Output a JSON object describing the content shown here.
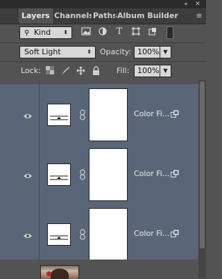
{
  "panel": {
    "tabs": [
      {
        "label": "Layers",
        "active": true
      },
      {
        "label": "Channels",
        "active": false
      },
      {
        "label": "Paths",
        "active": false
      },
      {
        "label": "Album Builder",
        "active": false
      }
    ],
    "window_controls": {
      "collapse": "«",
      "menu": "≡"
    }
  },
  "filter": {
    "kind_label": "Kind",
    "icons": [
      "image-filter-icon",
      "adjustment-filter-icon",
      "type-filter-icon",
      "shape-filter-icon",
      "smart-object-filter-icon",
      "filter-toggle-icon"
    ]
  },
  "blend": {
    "mode": "Soft Light",
    "opacity_label": "Opacity:",
    "opacity_value": "100%"
  },
  "locks": {
    "label": "Lock:",
    "fill_label": "Fill:",
    "fill_value": "100%"
  },
  "layers": [
    {
      "name": "Color Fi...",
      "visible": true,
      "selected": true
    },
    {
      "name": "Color Fi...",
      "visible": true,
      "selected": true
    },
    {
      "name": "Color Fi...",
      "visible": true,
      "selected": true
    }
  ],
  "colors": {
    "panel_bg": "#535353",
    "selected_layer": "#596677",
    "tab_bar": "#3c3c3c"
  }
}
